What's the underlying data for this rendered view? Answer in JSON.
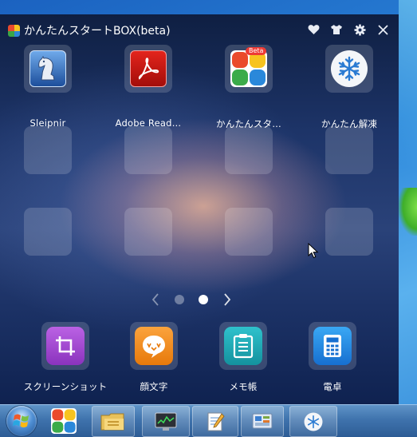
{
  "window": {
    "title": "かんたんスタートBOX(beta)"
  },
  "titlebar_icons": [
    "heart-icon",
    "tshirt-icon",
    "gear-icon",
    "close-icon"
  ],
  "apps": [
    {
      "label": "Sleipnir",
      "icon": "sleipnir-icon"
    },
    {
      "label": "Adobe Read…",
      "icon": "adobe-reader-icon"
    },
    {
      "label": "かんたんスタ…",
      "icon": "kantan-start-icon",
      "badge": "Beta"
    },
    {
      "label": "かんたん解凍",
      "icon": "kantan-kaito-icon"
    }
  ],
  "pager": {
    "pages": 2,
    "current": 2
  },
  "tools": [
    {
      "label": "スクリーンショット",
      "icon": "crop-icon",
      "color": "#a24ad0"
    },
    {
      "label": "顔文字",
      "icon": "emoticon-icon",
      "color": "#f08c1c"
    },
    {
      "label": "メモ帳",
      "icon": "memo-icon",
      "color": "#19a6b4"
    },
    {
      "label": "電卓",
      "icon": "calculator-icon",
      "color": "#1c8ee8"
    }
  ],
  "taskbar": {
    "items": [
      "start-orb",
      "kantan-start-icon",
      "explorer-icon",
      "system-monitor-icon",
      "notepad-icon",
      "control-panel-icon",
      "kantan-kaito-icon"
    ]
  }
}
